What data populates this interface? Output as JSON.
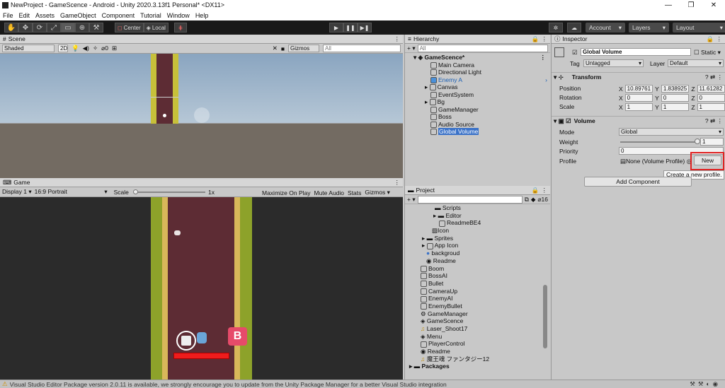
{
  "window": {
    "title": "NewProject - GameScence - Android - Unity 2020.3.13f1 Personal* <DX11>",
    "controls": [
      "—",
      "❐",
      "✕"
    ]
  },
  "menu": [
    "File",
    "Edit",
    "Assets",
    "GameObject",
    "Component",
    "Tutorial",
    "Window",
    "Help"
  ],
  "toolbar": {
    "tools": [
      "✋",
      "✥",
      "⟳",
      "⤢",
      "▭",
      "⊕",
      "⚒"
    ],
    "center": "Center",
    "local": "Local",
    "play": "▶",
    "pause": "❚❚",
    "step": "▶❚",
    "account": "Account",
    "layers": "Layers",
    "layout": "Layout"
  },
  "scene": {
    "tab": "Scene",
    "shading": "Shaded",
    "mode2d": "2D",
    "gizmos": "Gizmos",
    "search": "All",
    "layers_count": "0"
  },
  "game": {
    "tab": "Game",
    "display": "Display 1",
    "aspect": "16:9 Portrait",
    "scale_label": "Scale",
    "scale_value": "1x",
    "buttons": [
      "Maximize On Play",
      "Mute Audio",
      "Stats",
      "Gizmos"
    ]
  },
  "hierarchy": {
    "tab": "Hierarchy",
    "search": "All",
    "scene": "GameScence*",
    "items": [
      "Main Camera",
      "Directional Light",
      "Enemy A",
      "Canvas",
      "EventSystem",
      "Bg",
      "GameManager",
      "Boss",
      "Audio Source",
      "Global Volume"
    ],
    "selected": "Global Volume"
  },
  "project": {
    "tab": "Project",
    "count": "16",
    "items": [
      "Scripts",
      "Editor",
      "ReadmeBE4",
      "Icon",
      "Sprites",
      "App Icon",
      "backgroud",
      "Readme",
      "Boom",
      "BossAI",
      "Bullet",
      "CameraUp",
      "EnemyAI",
      "EnemyBullet",
      "GameManager",
      "GameScence",
      "Laser_Shoot17",
      "Menu",
      "PlayerControl",
      "Readme",
      "魔王魂 ファンタジー12",
      "Packages"
    ]
  },
  "inspector": {
    "tab": "Inspector",
    "object_name": "Global Volume",
    "static": "Static",
    "tag_label": "Tag",
    "tag": "Untagged",
    "layer_label": "Layer",
    "layer": "Default",
    "transform": {
      "title": "Transform",
      "position": "Position",
      "rotation": "Rotation",
      "scale": "Scale",
      "px": "10.89761",
      "py": "1.838925",
      "pz": "11.61282",
      "rx": "0",
      "ry": "0",
      "rz": "0",
      "sx": "1",
      "sy": "1",
      "sz": "1"
    },
    "volume": {
      "title": "Volume",
      "mode_label": "Mode",
      "mode": "Global",
      "weight_label": "Weight",
      "weight": "1",
      "priority_label": "Priority",
      "priority": "0",
      "profile_label": "Profile",
      "profile": "None (Volume Profile)",
      "new_button": "New",
      "tooltip": "Create a new profile."
    },
    "add_component": "Add Component"
  },
  "status": {
    "message": "Visual Studio Editor Package version 2.0.11 is available, we strongly encourage you to update from the Unity Package Manager for a better Visual Studio integration"
  },
  "colors": {
    "highlight": "#3a72c8",
    "accent_red": "#e02020",
    "editor_dark": "#191919"
  }
}
